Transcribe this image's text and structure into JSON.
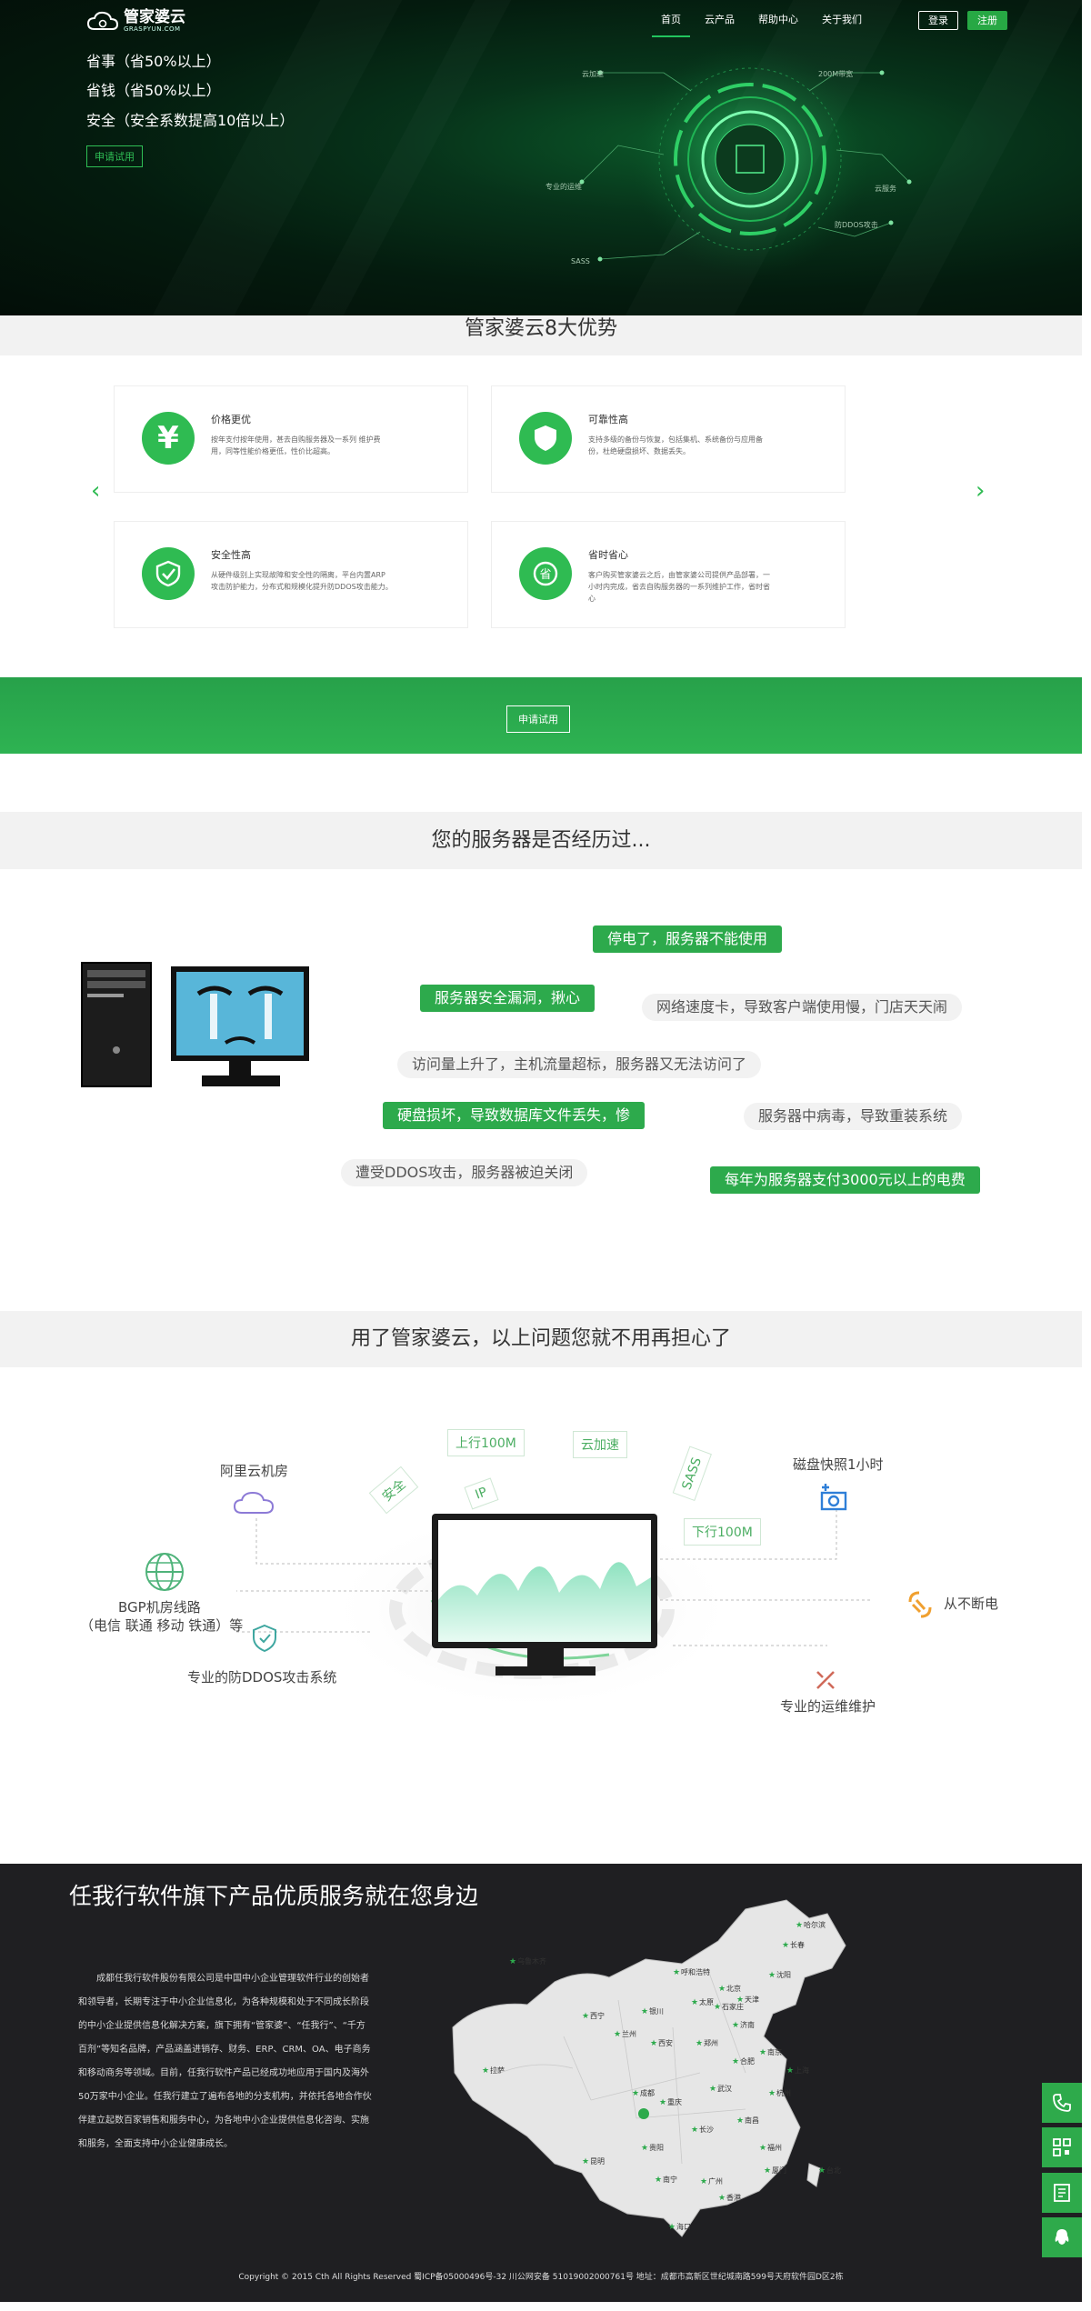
{
  "header": {
    "logo_name": "管家婆云",
    "logo_sub": "GRASPYUN.COM",
    "nav": [
      "首页",
      "云产品",
      "帮助中心",
      "关于我们"
    ],
    "login": "登录",
    "register": "注册"
  },
  "hero": {
    "slogans": [
      "省事（省50%以上）",
      "省钱（省50%以上）",
      "安全（安全系数提高10倍以上）"
    ],
    "trial_button": "申请试用",
    "graphic_labels": [
      "云加速",
      "200M带宽",
      "专业的运维",
      "云服务",
      "防DDOS攻击",
      "SASS"
    ]
  },
  "advantages": {
    "title": "管家婆云8大优势",
    "cards": [
      {
        "title": "价格更优",
        "desc": "按年支付按年使用，甚去自购服务器及一系列 维护费用，同等性能价格更低，性价比超高。",
        "icon": "yen-icon"
      },
      {
        "title": "可靠性高",
        "desc": "支持多级的备份与恢复，包括集机、系统备份与应用备份，杜绝硬盘损坏、数据丢失。",
        "icon": "shield-icon"
      },
      {
        "title": "安全性高",
        "desc": "从硬件级别上实现故障和安全性的隔离，平台内置ARP 攻击防护能力，分布式和规模化提升防DDOS攻击能力。",
        "icon": "shield-check-icon"
      },
      {
        "title": "省时省心",
        "desc": "客户购买管家婆云之后，由管家婆公司提供产品部署，一小时内完成，省去自购服务器的一系列维护工作，省时省心",
        "icon": "save-icon"
      }
    ]
  },
  "band": {
    "button": "申请试用"
  },
  "problems": {
    "title": "您的服务器是否经历过...",
    "items": [
      "停电了，服务器不能使用",
      "服务器安全漏洞，揪心",
      "网络速度卡，导致客户端使用慢，门店天天闹",
      "访问量上升了，主机流量超标，服务器又无法访问了",
      "硬盘损坏，导致数据库文件丢失，惨",
      "服务器中病毒，导致重装系统",
      "遭受DDOS攻击，服务器被迫关闭",
      "每年为服务器支付3000元以上的电费"
    ]
  },
  "solution": {
    "title": "用了管家婆云，以上问题您就不用再担心了",
    "features": {
      "aliyun": "阿里云机房",
      "bgp_line1": "BGP机房线路",
      "bgp_line2": "（电信 联通 移动 铁通）等",
      "ddos": "专业的防DDOS攻击系统",
      "snapshot": "磁盘快照1小时",
      "power": "从不断电",
      "ops": "专业的运维维护"
    },
    "tags": [
      "上行100M",
      "云加速",
      "安全",
      "IP",
      "SASS",
      "下行100M"
    ]
  },
  "footer": {
    "title": "任我行软件旗下产品优质服务就在您身边",
    "description": "成都任我行软件股份有限公司是中国中小企业管理软件行业的创始者和领导者，长期专注于中小企业信息化，为各种规模和处于不同成长阶段的中小企业提供信息化解决方案，旗下拥有“管家婆”、“任我行”、“千方百剂”等知名品牌，产品涵盖进销存、财务、ERP、CRM、OA、电子商务和移动商务等领域。目前，任我行软件产品已经成功地应用于国内及海外50万家中小企业。任我行建立了遍布各地的分支机构，并依托各地合作伙伴建立起数百家销售和服务中心，为各地中小企业提供信息化咨询、实施和服务，全面支持中小企业健康成长。",
    "cities": [
      "哈尔滨",
      "长春",
      "乌鲁木齐",
      "沈阳",
      "呼和浩特",
      "北京",
      "天津",
      "太原",
      "石家庄",
      "银川",
      "西宁",
      "兰州",
      "济南",
      "西安",
      "郑州",
      "南京",
      "合肥",
      "上海",
      "成都",
      "重庆",
      "武汉",
      "杭州",
      "拉萨",
      "贵阳",
      "长沙",
      "南昌",
      "福州",
      "昆明",
      "台北",
      "南宁",
      "广州",
      "海口",
      "厦门",
      "香港"
    ],
    "copyright": "Copyright © 2015 Cth All Rights Reserved 蜀ICP备05000496号-32  川公网安备 51019002000761号  地址：成都市高新区世纪城南路599号天府软件园D区2栋"
  },
  "side_buttons": [
    "phone-icon",
    "qrcode-icon",
    "form-icon",
    "qq-icon"
  ],
  "colors": {
    "brand_green": "#2daa4c",
    "hero_dark": "#041b0e",
    "footer_bg": "#1f1f22"
  }
}
